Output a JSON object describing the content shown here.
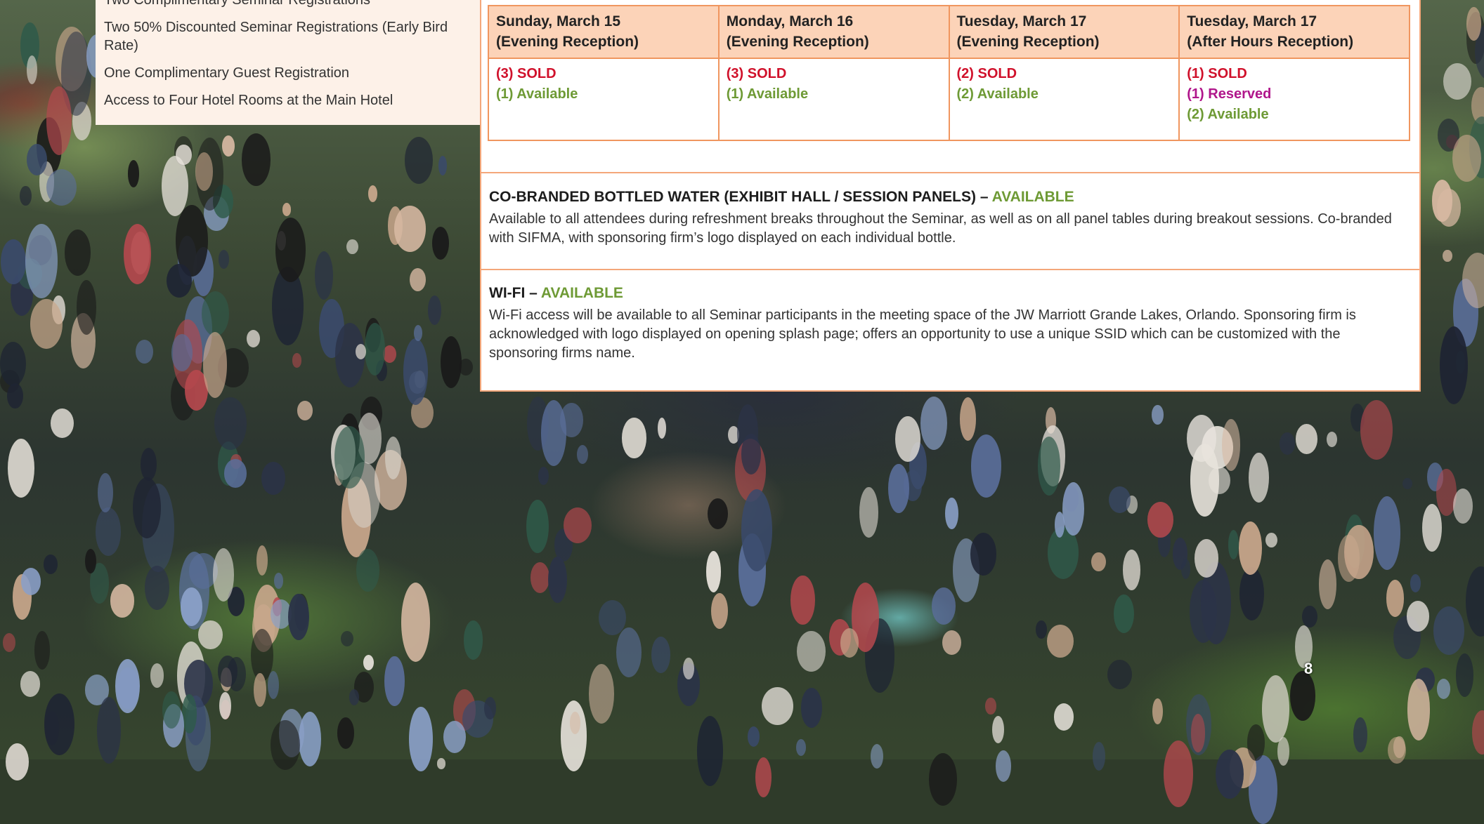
{
  "package": {
    "items": [
      "Two Complimentary Seminar Registrations",
      "Two 50% Discounted Seminar Registrations (Early Bird Rate)",
      "One Complimentary Guest Registration",
      "Access to Four Hotel Rooms at the Main Hotel"
    ]
  },
  "receptions": {
    "columns": [
      {
        "day": "Sunday, March 15",
        "event": "(Evening Reception)",
        "status": [
          {
            "type": "sold",
            "text": "(3) SOLD"
          },
          {
            "type": "available",
            "text": "(1) Available"
          }
        ]
      },
      {
        "day": "Monday, March 16",
        "event": "(Evening Reception)",
        "status": [
          {
            "type": "sold",
            "text": "(3) SOLD"
          },
          {
            "type": "available",
            "text": "(1) Available"
          }
        ]
      },
      {
        "day": "Tuesday, March 17",
        "event": "(Evening Reception)",
        "status": [
          {
            "type": "sold",
            "text": "(2) SOLD"
          },
          {
            "type": "available",
            "text": "(2) Available"
          }
        ]
      },
      {
        "day": "Tuesday, March 17",
        "event": "(After Hours Reception)",
        "status": [
          {
            "type": "sold",
            "text": "(1) SOLD"
          },
          {
            "type": "reserved",
            "text": "(1) Reserved"
          },
          {
            "type": "available",
            "text": "(2) Available"
          }
        ]
      }
    ]
  },
  "water": {
    "title": "CO-BRANDED BOTTLED WATER (EXHIBIT HALL / SESSION PANELS) –",
    "status": "AVAILABLE",
    "body": "Available to all attendees during refreshment breaks throughout the Seminar, as well as on all panel tables during breakout sessions. Co-branded with SIFMA, with sponsoring firm’s logo displayed on each individual bottle."
  },
  "wifi": {
    "title": "WI-FI –",
    "status": "AVAILABLE",
    "body": "Wi-Fi access will be available to all Seminar participants in the meeting space of the JW Marriott Grande Lakes, Orlando. Sponsoring firm is acknowledged with logo displayed on opening splash page; offers an opportunity to use a unique SSID which can be customized with the sponsoring firms name."
  },
  "page_number": "8",
  "colors": {
    "sold": "#d0112b",
    "available": "#6e9a35",
    "reserved": "#b0168b",
    "header_fill": "#fcd3b8",
    "border": "#f0965f"
  }
}
